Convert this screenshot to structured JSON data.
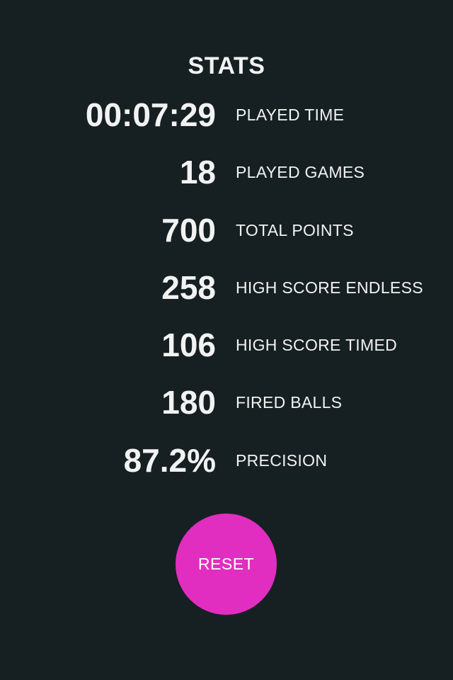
{
  "header": {
    "title": "STATS"
  },
  "stats": [
    {
      "value": "00:07:29",
      "label": "PLAYED TIME"
    },
    {
      "value": "18",
      "label": "PLAYED GAMES"
    },
    {
      "value": "700",
      "label": "TOTAL POINTS"
    },
    {
      "value": "258",
      "label": "HIGH SCORE ENDLESS"
    },
    {
      "value": "106",
      "label": "HIGH SCORE TIMED"
    },
    {
      "value": "180",
      "label": "FIRED BALLS"
    },
    {
      "value": "87.2%",
      "label": "PRECISION"
    }
  ],
  "actions": {
    "reset_label": "RESET"
  },
  "colors": {
    "background": "#162022",
    "text": "#f2f2f2",
    "accent": "#e12ec0"
  }
}
